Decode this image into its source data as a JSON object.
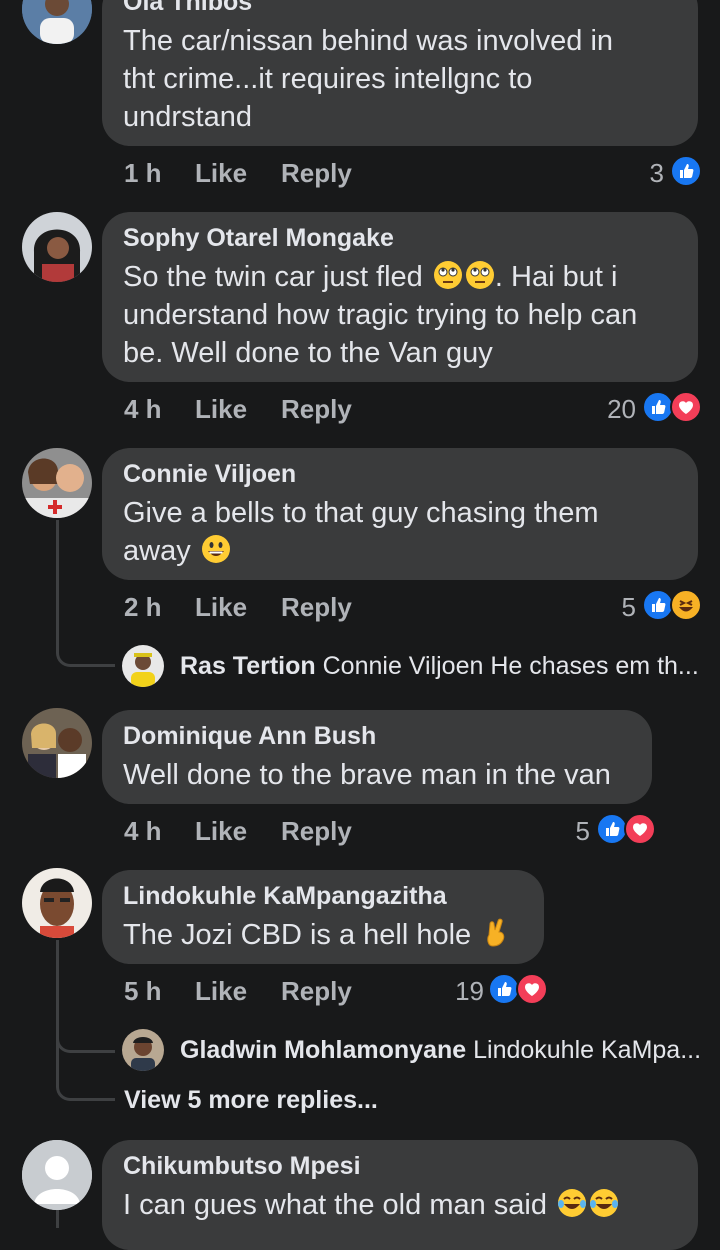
{
  "comments": [
    {
      "author": "Ola Thibos",
      "lines": [
        "The car/nissan behind was involved in",
        "tht crime...it requires intellgnc to",
        "undrstand"
      ],
      "time": "1 h",
      "like": "Like",
      "reply": "Reply",
      "count": "3"
    },
    {
      "author": "Sophy Otarel Mongake",
      "lines": [
        "So the twin car just fled",
        ". Hai but i",
        "understand how tragic trying to help can",
        "be. Well done to the Van guy"
      ],
      "time": "4 h",
      "like": "Like",
      "reply": "Reply",
      "count": "20"
    },
    {
      "author": "Connie Viljoen",
      "lines": [
        "Give a bells to that guy chasing them",
        "away"
      ],
      "time": "2 h",
      "like": "Like",
      "reply": "Reply",
      "count": "5",
      "reply_preview": {
        "author": "Ras Tertion",
        "text": "Connie Viljoen He chases em th..."
      }
    },
    {
      "author": "Dominique Ann Bush",
      "lines": [
        "Well done to the brave man in the van"
      ],
      "time": "4 h",
      "like": "Like",
      "reply": "Reply",
      "count": "5"
    },
    {
      "author": "Lindokuhle KaMpangazitha",
      "lines": [
        "The Jozi CBD is a hell hole"
      ],
      "time": "5 h",
      "like": "Like",
      "reply": "Reply",
      "count": "19",
      "reply_preview": {
        "author": "Gladwin Mohlamonyane",
        "text": "Lindokuhle KaMpa..."
      },
      "view_more": "View 5 more replies..."
    },
    {
      "author": "Chikumbutso Mpesi",
      "lines": [
        "I can gues what the old man said"
      ]
    }
  ],
  "colors": {
    "background": "#18191a",
    "bubble": "#3a3b3c",
    "like": "#1877f2",
    "love": "#f33e58",
    "haha": "#f7b125"
  }
}
